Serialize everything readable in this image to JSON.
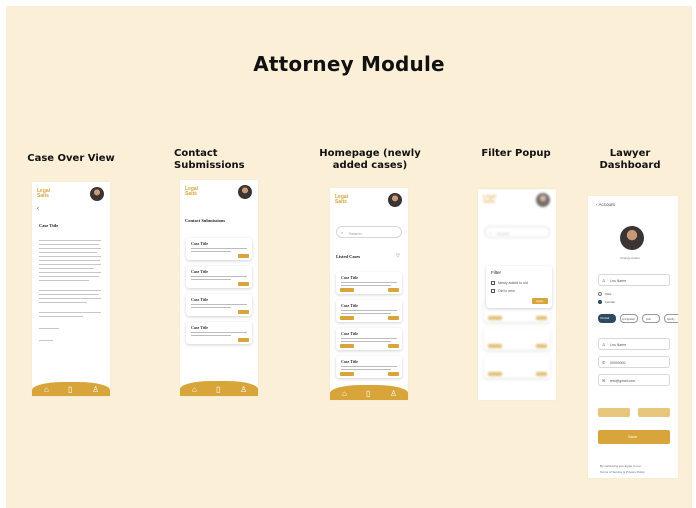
{
  "page_title": "Attorney Module",
  "sections": {
    "case_overview": "Case Over View",
    "contact_submissions": "Contact Submissions",
    "homepage": "Homepage (newly added cases)",
    "filter_popup": "Filter Popup",
    "lawyer_dashboard": "Lawyer Dashboard"
  },
  "logo": {
    "line1": "Legal",
    "line2": "Salts"
  },
  "case_overview": {
    "back": "‹",
    "case_title": "Case Title"
  },
  "contact": {
    "heading": "Contact Submissions",
    "card_title": "Case Title"
  },
  "homepage": {
    "search_placeholder": "Search",
    "listed_cases": "Listed Cases",
    "card_title": "Case Title"
  },
  "filter": {
    "search_placeholder": "Search",
    "popup_title": "Filter",
    "option1": "Newly added to old",
    "option2": "Old to new",
    "apply": "Apply"
  },
  "dashboard": {
    "back_label": "Account",
    "change_avatar": "Change Avatar",
    "name_value": "Leo Name",
    "gender_male": "Male",
    "gender_female": "Female",
    "phone_value": "00000000",
    "email_value": "test@gmail.com",
    "save_label": "Save",
    "footer_line1": "By continuing you agree to our",
    "footer_line2": "Terms of Service & Privacy Policy",
    "chips": [
      "Criminal",
      "Immigration",
      "Civil",
      "Family"
    ]
  },
  "icons": {
    "home": "home-icon",
    "document": "document-icon",
    "profile": "user-icon",
    "search": "search-icon",
    "filter": "filter-icon"
  },
  "colors": {
    "background": "#fcefd8",
    "accent": "#d8a53a",
    "chip_selected": "#2c4a63"
  }
}
